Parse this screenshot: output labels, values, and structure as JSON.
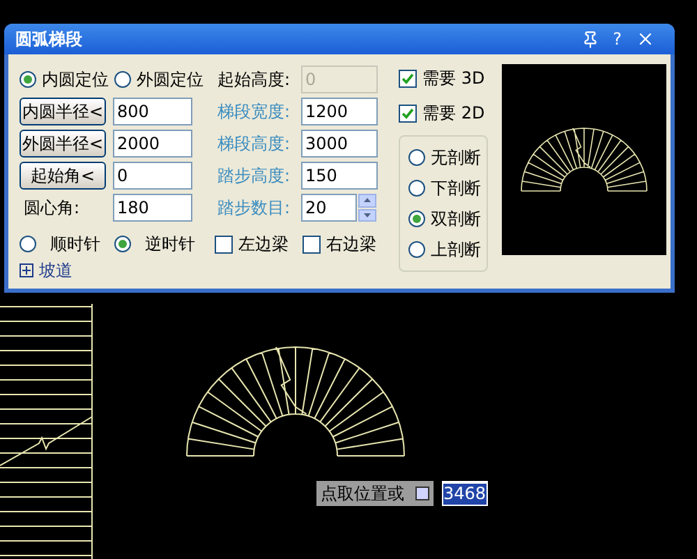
{
  "dialog": {
    "title": "圆弧梯段",
    "help_label": "?",
    "positioning": [
      {
        "label": "内圆定位",
        "selected": true
      },
      {
        "label": "外圆定位",
        "selected": false
      }
    ],
    "left_fields": [
      {
        "kind": "button",
        "label": "内圆半径<",
        "value": "800"
      },
      {
        "kind": "button",
        "label": "外圆半径<",
        "value": "2000"
      },
      {
        "kind": "button",
        "label": "起始角<",
        "value": "0"
      },
      {
        "kind": "label",
        "label": "圆心角:",
        "value": "180"
      }
    ],
    "right_fields": [
      {
        "kind": "text",
        "label": "起始高度:",
        "value": "0",
        "disabled": true,
        "color": "#000000"
      },
      {
        "kind": "text",
        "label": "梯段宽度:",
        "value": "1200",
        "disabled": false,
        "color": "#3a8cc0"
      },
      {
        "kind": "text",
        "label": "梯段高度:",
        "value": "3000",
        "disabled": false,
        "color": "#3a8cc0"
      },
      {
        "kind": "text",
        "label": "踏步高度:",
        "value": "150",
        "disabled": false,
        "color": "#3a8cc0"
      },
      {
        "kind": "spinner",
        "label": "踏步数目:",
        "value": "20",
        "disabled": false,
        "color": "#3a8cc0"
      }
    ],
    "direction": [
      {
        "label": "顺时针",
        "selected": false
      },
      {
        "label": "逆时针",
        "selected": true
      }
    ],
    "beams": [
      {
        "label": "左边梁",
        "checked": false
      },
      {
        "label": "右边梁",
        "checked": false
      }
    ],
    "ramp": {
      "label": "坡道",
      "expanded": false
    },
    "options": [
      {
        "label": "需要 3D",
        "checked": true
      },
      {
        "label": "需要 2D",
        "checked": true
      }
    ],
    "section": [
      {
        "label": "无剖断",
        "selected": false
      },
      {
        "label": "下剖断",
        "selected": false
      },
      {
        "label": "双剖断",
        "selected": true
      },
      {
        "label": "上剖断",
        "selected": false
      }
    ]
  },
  "command": {
    "label": "点取位置或",
    "value": "3468"
  }
}
